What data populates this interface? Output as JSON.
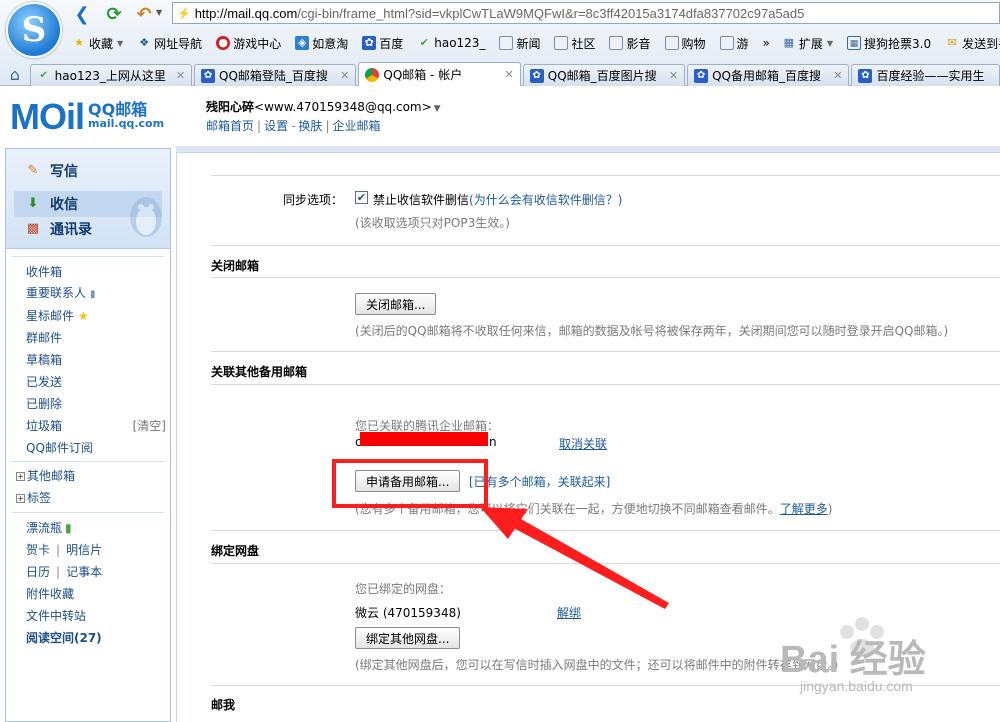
{
  "browser": {
    "logo_letter": "S",
    "url_host": "http://mail.qq.com",
    "url_path": "/cgi-bin/frame_html?sid=vkplCwTLaW9MQFwI&r=8c3ff42015a3174dfa837702c97a5ad5",
    "bookmarks": [
      {
        "label": "收藏",
        "icon": "star-icon",
        "color": "#f0b400"
      },
      {
        "label": "网址导航",
        "icon": "compass-icon",
        "color": "#1d5a9c"
      },
      {
        "label": "游戏中心",
        "icon": "game-icon",
        "color": "#d42020"
      },
      {
        "label": "如意淘",
        "icon": "shop-icon",
        "color": "#2d7fd3"
      },
      {
        "label": "百度",
        "icon": "paw-icon",
        "color": "#2a5fc8"
      },
      {
        "label": "hao123_",
        "icon": "hao-icon",
        "color": "#4aa33c"
      },
      {
        "label": "新闻",
        "icon": "folder-icon",
        "color": "#7b8fa8"
      },
      {
        "label": "社区",
        "icon": "folder-icon",
        "color": "#7b8fa8"
      },
      {
        "label": "影音",
        "icon": "folder-icon",
        "color": "#7b8fa8"
      },
      {
        "label": "购物",
        "icon": "folder-icon",
        "color": "#7b8fa8"
      },
      {
        "label": "游",
        "icon": "folder-icon",
        "color": "#7b8fa8"
      }
    ],
    "more_glyph": "»",
    "extensions": [
      {
        "label": "扩展",
        "icon": "grid-icon"
      },
      {
        "label": "搜狗抢票3.0",
        "icon": "ticket-icon"
      },
      {
        "label": "发送到手机",
        "icon": "phone-icon"
      }
    ],
    "tabs": [
      {
        "label": "hao123_上网从这里",
        "icon": "hao-icon",
        "active": false
      },
      {
        "label": "QQ邮箱登陆_百度搜",
        "icon": "paw-icon",
        "active": false
      },
      {
        "label": "QQ邮箱 - 帐户",
        "icon": "chrome-icon",
        "active": true
      },
      {
        "label": "QQ邮箱_百度图片搜",
        "icon": "paw-icon",
        "active": false
      },
      {
        "label": "QQ备用邮箱_百度搜",
        "icon": "paw-icon",
        "active": false
      },
      {
        "label": "百度经验——实用生",
        "icon": "paw-icon",
        "active": false
      }
    ],
    "close_glyph": "✕"
  },
  "header": {
    "logo_text": "MOil",
    "logo_cn": "QQ邮箱",
    "logo_en": "mail.qq.com",
    "user_name": "残阳心碎",
    "user_email": "<www.470159348@qq.com>",
    "links": [
      "邮箱首页",
      "设置",
      "换肤",
      "企业邮箱"
    ]
  },
  "sidebar": {
    "quick": [
      {
        "label": "写信",
        "icon": "pencil-icon"
      },
      {
        "label": "收信",
        "icon": "inbox-icon"
      },
      {
        "label": "通讯录",
        "icon": "contacts-icon"
      }
    ],
    "folders": [
      {
        "label": "收件箱"
      },
      {
        "label": "重要联系人"
      },
      {
        "label": "星标邮件"
      },
      {
        "label": "群邮件"
      },
      {
        "label": "草稿箱"
      },
      {
        "label": "已发送"
      },
      {
        "label": "已删除"
      },
      {
        "label": "垃圾箱",
        "extra": "[清空]"
      },
      {
        "label": "QQ邮件订阅"
      }
    ],
    "groups": [
      "其他邮箱",
      "标签"
    ],
    "tools": {
      "drift": "漂流瓶",
      "cards": "贺卡",
      "postcard": "明信片",
      "calendar": "日历",
      "notes": "记事本",
      "attachments": "附件收藏",
      "transfer": "文件中转站",
      "reading": "阅读空间(27)"
    }
  },
  "main": {
    "sync": {
      "label": "同步选项：",
      "checkbox_label": "禁止收信软件删信",
      "help_link": "(为什么会有收信软件删信？)",
      "note": "(该收取选项只对POP3生效。)",
      "checked": true
    },
    "close_mailbox": {
      "title": "关闭邮箱",
      "button": "关闭邮箱...",
      "note": "(关闭后的QQ邮箱将不收取任何来信，邮箱的数据及帐号将被保存两年，关闭期间您可以随时登录开启QQ邮箱。)"
    },
    "backup": {
      "title": "关联其他备用邮箱",
      "linked_label": "您已关联的腾讯企业邮箱：",
      "linked_value_start": "c",
      "linked_value_end": "n",
      "unlink": "取消关联",
      "button": "申请备用邮箱...",
      "hint": "[已有多个邮箱，关联起来]",
      "note_start": "(您有多个备用邮箱，您可以将它们关联在一起，方便地切换不同邮箱查看邮件。",
      "more": "了解更多",
      "note_end": ")"
    },
    "netdisk": {
      "title": "绑定网盘",
      "bound_label": "您已绑定的网盘：",
      "bound_value": "微云 (470159348)",
      "unbind": "解绑",
      "button": "绑定其他网盘...",
      "note": "(绑定其他网盘后，您可以在写信时插入网盘中的文件；还可以将邮件中的附件转存到网盘。)"
    },
    "last_section": "邮我"
  },
  "annotation": {
    "highlight_color": "#ff1e1e",
    "redact_color": "#ff0000"
  },
  "watermark": {
    "text": "Bai 经验",
    "sub": "jingyan.baidu.com"
  }
}
